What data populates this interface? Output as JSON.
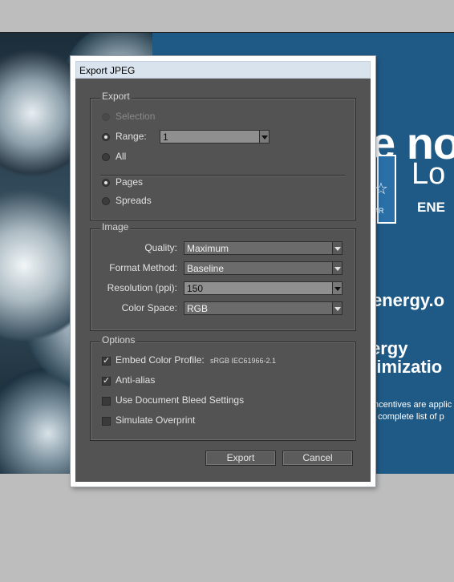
{
  "background_doc": {
    "headline": "e no",
    "logo_word": "Lo",
    "logo_sub": "ENE",
    "logo_small": "AR",
    "website": "energy.o",
    "program_line1": "ergy",
    "program_line2": "timizatio",
    "fine_line1": "ncentives are applic",
    "fine_line2": "a complete list of p"
  },
  "dialog": {
    "title": "Export JPEG",
    "export_group": {
      "label": "Export",
      "selection_label": "Selection",
      "range_label": "Range:",
      "range_value": "1",
      "all_label": "All",
      "pages_label": "Pages",
      "spreads_label": "Spreads",
      "selected_scope": "Range",
      "selected_mode": "Pages"
    },
    "image_group": {
      "label": "Image",
      "quality_label": "Quality:",
      "quality_value": "Maximum",
      "format_label": "Format Method:",
      "format_value": "Baseline",
      "resolution_label": "Resolution (ppi):",
      "resolution_value": "150",
      "colorspace_label": "Color Space:",
      "colorspace_value": "RGB"
    },
    "options_group": {
      "label": "Options",
      "embed_label": "Embed Color Profile:",
      "embed_profile": "sRGB IEC61966-2.1",
      "embed_checked": true,
      "antialias_label": "Anti-alias",
      "antialias_checked": true,
      "bleed_label": "Use Document Bleed Settings",
      "bleed_checked": false,
      "overprint_label": "Simulate Overprint",
      "overprint_checked": false
    },
    "buttons": {
      "export": "Export",
      "cancel": "Cancel"
    }
  },
  "colors": {
    "dialog_body": "#535353",
    "titlebar": "#d8e3ee",
    "doc_blue": "#1f5a86",
    "app_background": "#bdbdbd"
  }
}
